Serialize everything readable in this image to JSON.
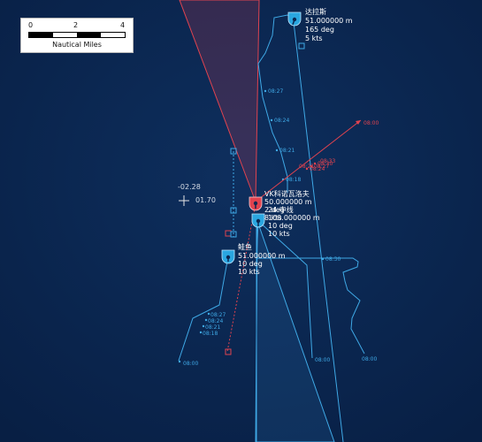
{
  "scale_bar": {
    "ticks": [
      "0",
      "2",
      "4"
    ],
    "unit": "Nautical Miles"
  },
  "cursor": {
    "x_readout": "-02.28",
    "y_readout": "01.70"
  },
  "vessels": [
    {
      "name": "达拉斯",
      "depth": "51.000000 m",
      "heading": "165 deg",
      "speed": "5 kts",
      "color": "#3fa9e6",
      "track_times": [
        "08:27",
        "08:24",
        "08:21",
        "08:18"
      ]
    },
    {
      "name": "VK科诺瓦洛夫",
      "depth": "50.000000 m",
      "heading": "2 deg",
      "speed": "8 kts",
      "color": "#e0434f",
      "track_times": [
        "08:00",
        "08:30",
        "08:27",
        "08:24",
        "08:33",
        "08:21"
      ]
    },
    {
      "name": "24 中线",
      "depth": "100.000000 m",
      "heading": "10 deg",
      "speed": "10 kts",
      "color": "#3fa9e6",
      "track_times": [
        "08:30",
        "08:00",
        "08:00"
      ]
    },
    {
      "name": "鲑鱼",
      "depth": "51.000000 m",
      "heading": "10 deg",
      "speed": "10 kts",
      "color": "#3fa9e6",
      "track_times": [
        "08:27",
        "08:24",
        "08:21",
        "08:18",
        "08:00"
      ]
    }
  ],
  "colors": {
    "friendly": "#3fa9e6",
    "hostile": "#e0434f",
    "sea": "#0a2752"
  }
}
